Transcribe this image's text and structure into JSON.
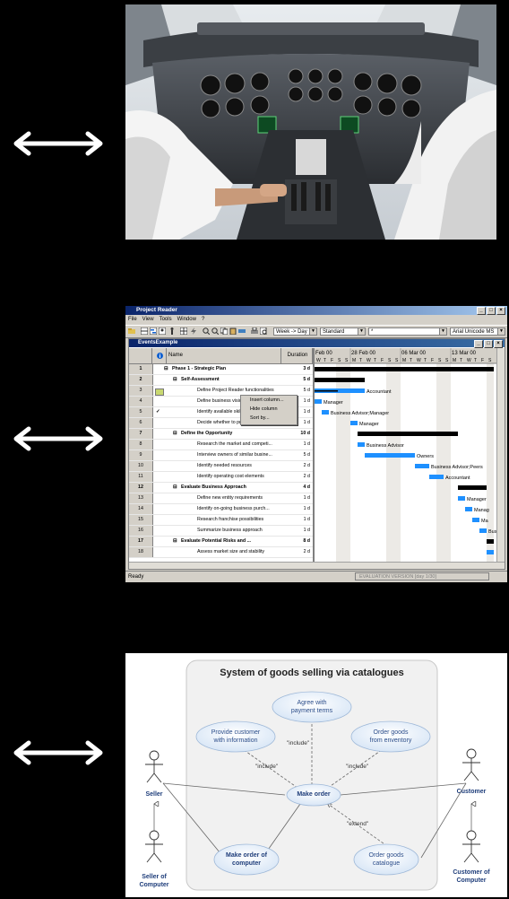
{
  "project_reader": {
    "title": "Project Reader",
    "menu": [
      "File",
      "View",
      "Tools",
      "Window",
      "?"
    ],
    "timescale": "Week -> Day",
    "calendar": "Standard",
    "filter": "*",
    "font": "Arial Unicode MS",
    "document_title": "EventsExample",
    "columns": {
      "name": "Name",
      "duration": "Duration"
    },
    "context_menu": [
      "Insert column...",
      "Hide column",
      "Sort by..."
    ],
    "weeks": [
      "Feb 00",
      "28 Feb 00",
      "06 Mar 00",
      "13 Mar 00"
    ],
    "day_letters": [
      "W",
      "T",
      "F",
      "S",
      "S",
      "M",
      "T",
      "W",
      "T",
      "F",
      "S",
      "S",
      "M",
      "T",
      "W",
      "T",
      "F",
      "S",
      "S",
      "M",
      "T",
      "W",
      "T",
      "F",
      "S"
    ],
    "tasks": [
      {
        "id": "1",
        "name": "Phase 1 - Strategic Plan",
        "duration": "3 d",
        "summary": true,
        "level": 0
      },
      {
        "id": "2",
        "name": "Self-Assessment",
        "duration": "5 d",
        "summary": true,
        "level": 1
      },
      {
        "id": "3",
        "name": "Define Project Reader functionalities",
        "duration": "5 d",
        "summary": false,
        "level": 2
      },
      {
        "id": "4",
        "name": "Define business vision",
        "duration": "1 d",
        "summary": false,
        "level": 2
      },
      {
        "id": "5",
        "name": "Identify available skills, informatio...",
        "duration": "1 d",
        "summary": false,
        "level": 2
      },
      {
        "id": "6",
        "name": "Decide whether to proceed",
        "duration": "1 d",
        "summary": false,
        "level": 2
      },
      {
        "id": "7",
        "name": "Define the Opportunity",
        "duration": "10 d",
        "summary": true,
        "level": 1
      },
      {
        "id": "8",
        "name": "Research the market and competi...",
        "duration": "1 d",
        "summary": false,
        "level": 2
      },
      {
        "id": "9",
        "name": "Interview owners of similar busine...",
        "duration": "5 d",
        "summary": false,
        "level": 2
      },
      {
        "id": "10",
        "name": "Identify needed resources",
        "duration": "2 d",
        "summary": false,
        "level": 2
      },
      {
        "id": "11",
        "name": "Identify operating cost elements",
        "duration": "2 d",
        "summary": false,
        "level": 2
      },
      {
        "id": "12",
        "name": "Evaluate Business Approach",
        "duration": "4 d",
        "summary": true,
        "level": 1
      },
      {
        "id": "13",
        "name": "Define new entity requirements",
        "duration": "1 d",
        "summary": false,
        "level": 2
      },
      {
        "id": "14",
        "name": "Identify on-going business purch...",
        "duration": "1 d",
        "summary": false,
        "level": 2
      },
      {
        "id": "15",
        "name": "Research franchise possibilities",
        "duration": "1 d",
        "summary": false,
        "level": 2
      },
      {
        "id": "16",
        "name": "Summarize business approach",
        "duration": "1 d",
        "summary": false,
        "level": 2
      },
      {
        "id": "17",
        "name": "Evaluate Potential Risks and ...",
        "duration": "8 d",
        "summary": true,
        "level": 1
      },
      {
        "id": "18",
        "name": "Assess market size and stability",
        "duration": "2 d",
        "summary": false,
        "level": 2
      }
    ],
    "resource_labels": [
      "Accountant",
      "Manager",
      "Business Advisor;Manager",
      "Manager",
      "Business Advisor",
      "Owners",
      "Business Advisor;Peers",
      "Accountant",
      "Manager",
      "Manag",
      "Ma",
      "Bus"
    ],
    "status": "Ready",
    "evaluation": "EVALUATION VERSION  [day 1/30]"
  },
  "uml": {
    "title": "System of goods selling via catalogues",
    "use_cases": {
      "agree": "Agree with\npayment terms",
      "provide": "Provide customer\nwith information",
      "order_goods": "Order goods\nfrom enventory",
      "make_order": "Make order",
      "make_order_computer": "Make order of\ncomputer",
      "order_catalogue": "Order goods\ncatalogue"
    },
    "stereotypes": {
      "include1": "\"include\"",
      "include2": "\"include\"",
      "include3": "\"include\"",
      "extend": "\"extend\""
    },
    "actors": {
      "seller": "Seller",
      "seller_computer": "Seller of\nComputer",
      "customer": "Customer",
      "customer_computer": "Customer of\nComputer"
    }
  }
}
